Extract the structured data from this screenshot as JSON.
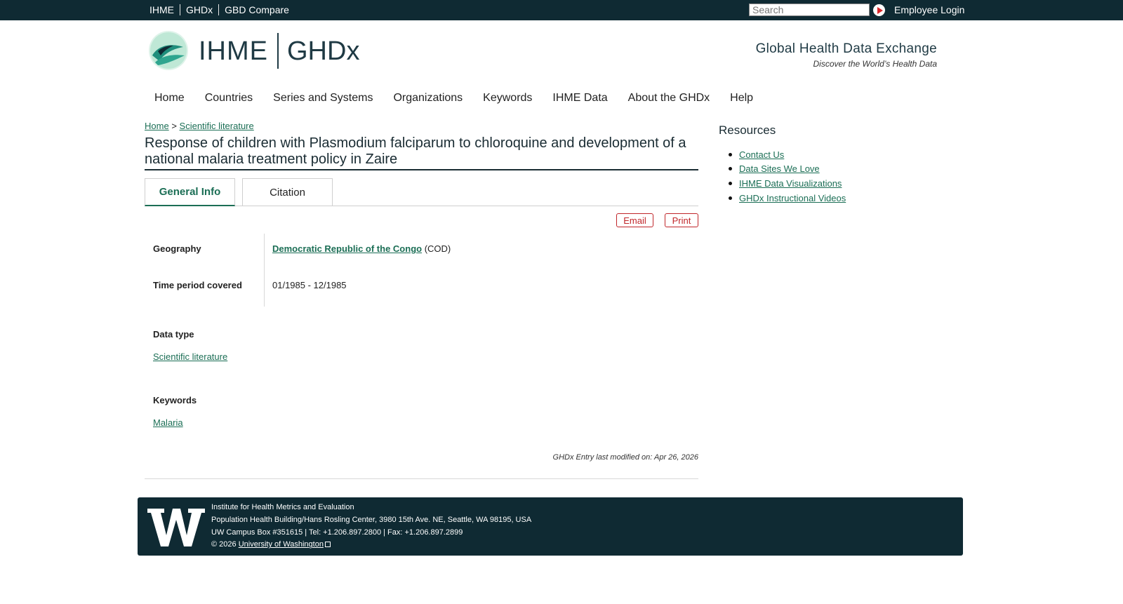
{
  "topbar": {
    "links": [
      "IHME",
      "GHDx",
      "GBD Compare"
    ],
    "search_placeholder": "Search",
    "employee_login": "Employee Login"
  },
  "header": {
    "logo_left": "IHME",
    "logo_right": "GHDx",
    "tagline": "Global Health Data Exchange",
    "subtagline": "Discover the World’s Health Data"
  },
  "nav": {
    "items": [
      "Home",
      "Countries",
      "Series and Systems",
      "Organizations",
      "Keywords",
      "IHME Data",
      "About the GHDx",
      "Help"
    ]
  },
  "breadcrumb": {
    "home": "Home",
    "separator": ">",
    "current": "Scientific literature"
  },
  "page": {
    "title": "Response of children with Plasmodium falciparum to chloroquine and development of a national malaria treatment policy in Zaire"
  },
  "tabs": {
    "general": "General Info",
    "citation": "Citation"
  },
  "actions": {
    "email": "Email",
    "print": "Print"
  },
  "info": {
    "geography_label": "Geography",
    "geography_link": "Democratic Republic of the Congo",
    "geography_code": "(COD)",
    "time_label": "Time period covered",
    "time_value": "01/1985 - 12/1985",
    "datatype_label": "Data type",
    "datatype_link": "Scientific literature",
    "keywords_label": "Keywords",
    "keywords_link": "Malaria",
    "modified": "GHDx Entry last modified on: Apr 26, 2026"
  },
  "sidebar": {
    "title": "Resources",
    "links": [
      "Contact Us",
      "Data Sites We Love",
      "IHME Data Visualizations",
      "GHDx Instructional Videos"
    ]
  },
  "footer": {
    "line1": "Institute for Health Metrics and Evaluation",
    "line2": "Population Health Building/Hans Rosling Center, 3980 15th Ave. NE, Seattle, WA 98195, USA",
    "line3": "UW Campus Box #351615 | Tel: +1.206.897.2800 | Fax: +1.206.897.2899",
    "copyright": "© 2026",
    "uw_link": "University of Washington"
  },
  "colors": {
    "topbar": "#0f2a33",
    "link_green": "#1b6e55",
    "action_red": "#c0262a"
  }
}
